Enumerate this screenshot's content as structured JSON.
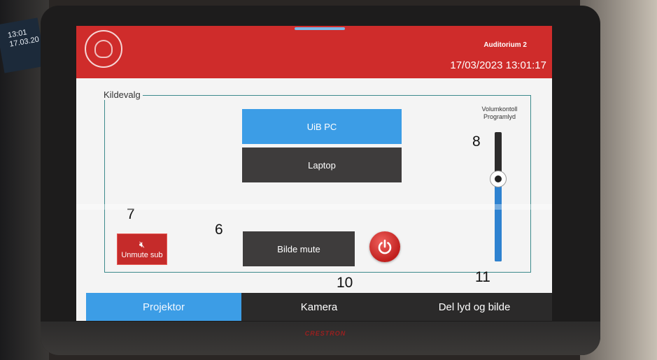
{
  "environment": {
    "small_screen_lines": [
      "13:01",
      "17.03.20"
    ],
    "device_brand": "CRESTRON"
  },
  "header": {
    "room": "Auditorium 2",
    "datetime": "17/03/2023 13:01:17",
    "accent_color": "#cf2c2b"
  },
  "source_group": {
    "label": "Kildevalg",
    "sources": [
      {
        "label": "UiB PC",
        "selected": true
      },
      {
        "label": "Laptop",
        "selected": false
      }
    ]
  },
  "controls": {
    "unmute_sub_label": "Unmute sub",
    "unmute_icon": "speaker-muted-icon",
    "bilde_mute_label": "Bilde mute",
    "power_icon": "power-icon"
  },
  "volume": {
    "label_line1": "Volumkontoll",
    "label_line2": "Programlyd",
    "level": 0.64
  },
  "annotations": {
    "m6": "6",
    "m7": "7",
    "m8": "8",
    "m10": "10",
    "m11": "11"
  },
  "tabs": [
    {
      "label": "Projektor",
      "active": true
    },
    {
      "label": "Kamera",
      "active": false
    },
    {
      "label": "Del lyd og bilde",
      "active": false
    }
  ],
  "colors": {
    "selected_blue": "#3c9de6",
    "dark_button": "#3e3c3c",
    "volume_fill": "#2e82d0"
  }
}
